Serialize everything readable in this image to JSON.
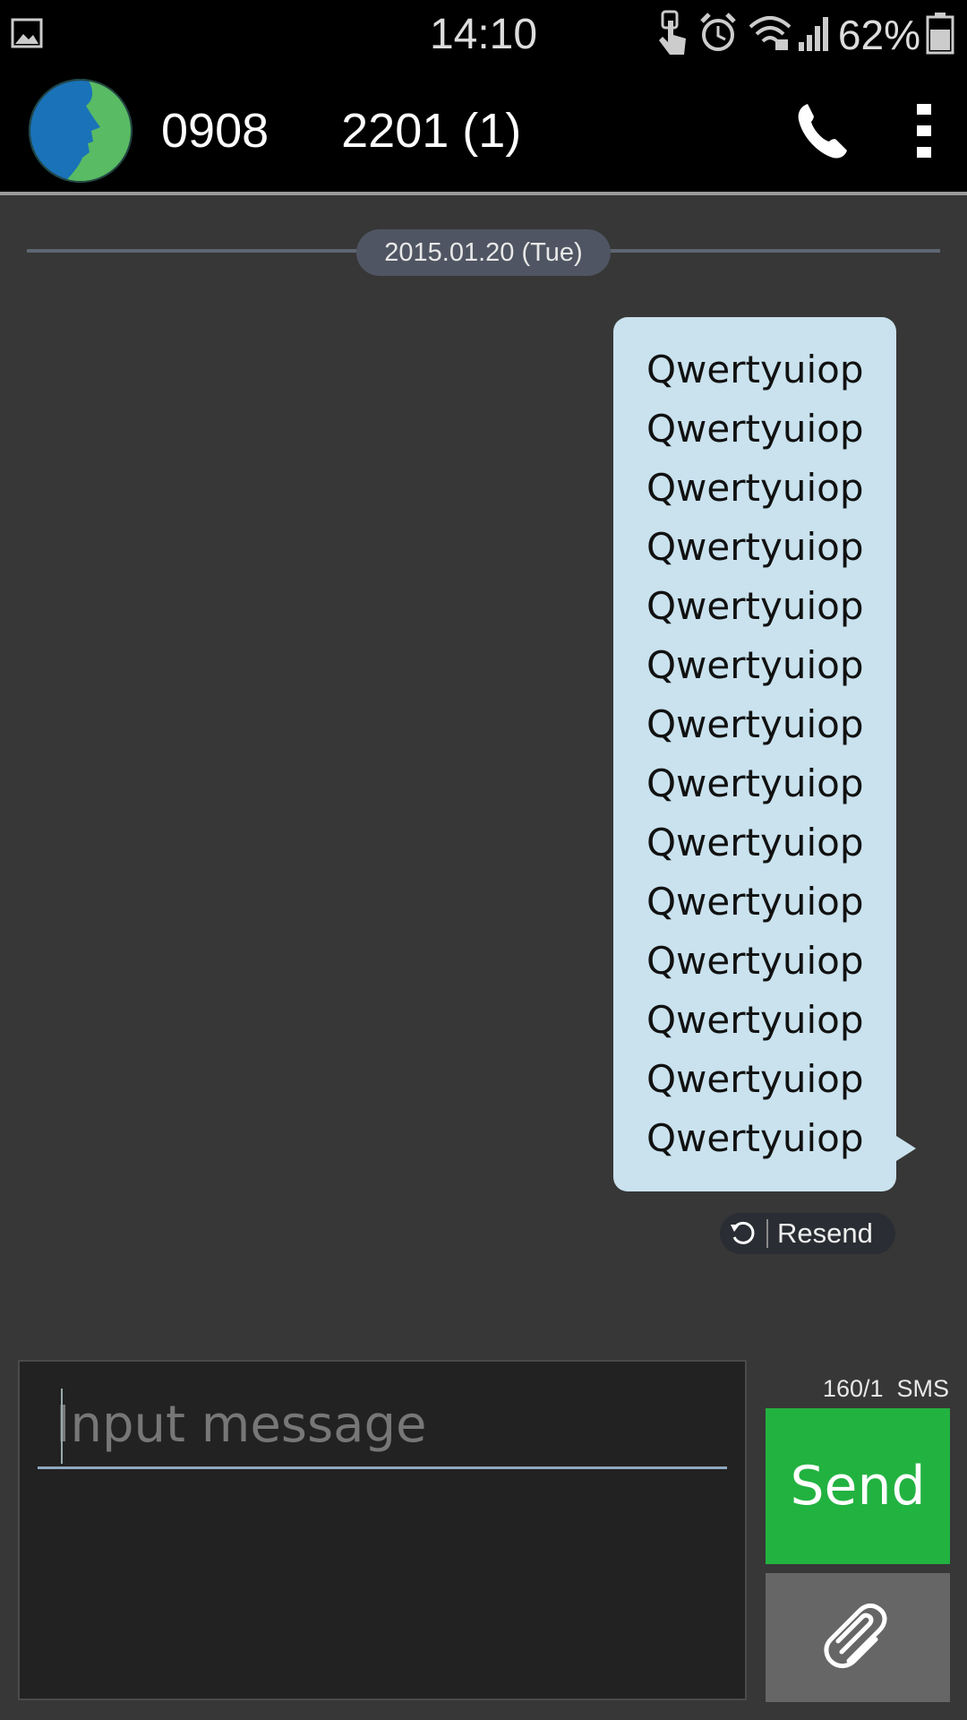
{
  "status_bar": {
    "time": "14:10",
    "battery_text": "62%",
    "icons": [
      "gallery-icon",
      "touch-icon",
      "alarm-icon",
      "wifi-icon",
      "signal-icon",
      "battery-icon"
    ]
  },
  "header": {
    "contact_name": "0908   2201 (1)",
    "icons": [
      "avatar",
      "phone-icon",
      "overflow-menu-icon"
    ]
  },
  "conversation": {
    "date": "2015.01.20 (Tue)",
    "messages": [
      {
        "direction": "outgoing",
        "lines": [
          "Qwertyuiop",
          "Qwertyuiop",
          "Qwertyuiop",
          "Qwertyuiop",
          "Qwertyuiop",
          "Qwertyuiop",
          "Qwertyuiop",
          "Qwertyuiop",
          "Qwertyuiop",
          "Qwertyuiop",
          "Qwertyuiop",
          "Qwertyuiop",
          "Qwertyuiop",
          "Qwertyuiop"
        ],
        "resend_label": "Resend"
      }
    ]
  },
  "compose": {
    "placeholder": "Input message",
    "value": "",
    "counter": "160/1  SMS",
    "send_label": "Send"
  },
  "colors": {
    "background": "#373737",
    "bubble": "#c9e2ee",
    "send": "#22b240",
    "attach": "#666666"
  }
}
